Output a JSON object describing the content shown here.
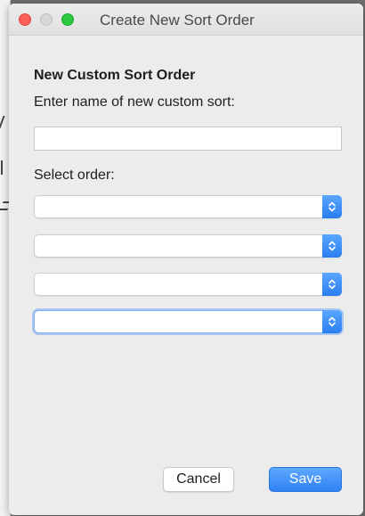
{
  "window": {
    "title": "Create New Sort Order"
  },
  "form": {
    "heading": "New Custom Sort Order",
    "name_label": "Enter name of new custom sort:",
    "name_value": "",
    "order_label": "Select order:",
    "selects": [
      {
        "value": ""
      },
      {
        "value": ""
      },
      {
        "value": ""
      },
      {
        "value": ""
      }
    ]
  },
  "buttons": {
    "cancel_label": "Cancel",
    "save_label": "Save"
  },
  "colors": {
    "accent": "#2e82f2",
    "close": "#fc5f57",
    "maximize": "#2bc840"
  }
}
